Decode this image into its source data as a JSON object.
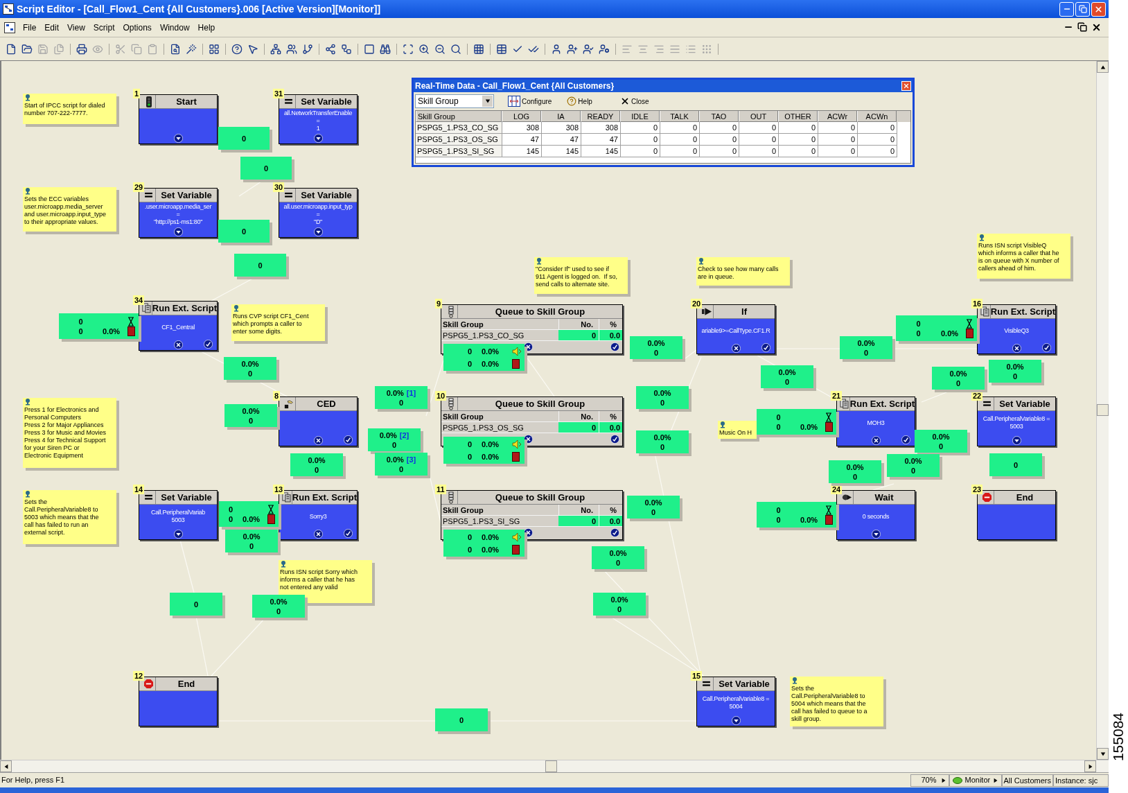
{
  "window": {
    "title": "Script Editor - [Call_Flow1_Cent {All Customers}.006 [Active Version][Monitor]]"
  },
  "menu": [
    "File",
    "Edit",
    "View",
    "Script",
    "Options",
    "Window",
    "Help"
  ],
  "toolbar": [
    [
      {
        "disabled": false
      },
      {
        "disabled": false
      },
      {
        "disabled": true
      },
      {
        "disabled": true
      }
    ],
    [
      {
        "disabled": false
      },
      {
        "disabled": true
      }
    ],
    [
      {
        "disabled": true
      },
      {
        "disabled": true
      },
      {
        "disabled": true
      }
    ],
    [
      {
        "disabled": false
      },
      {
        "disabled": false
      }
    ],
    [
      {
        "disabled": false
      }
    ],
    [
      {
        "disabled": false
      },
      {
        "disabled": false
      }
    ],
    [
      {
        "disabled": false
      },
      {
        "disabled": false
      },
      {
        "disabled": false
      }
    ],
    [
      {
        "disabled": false
      },
      {
        "disabled": false
      }
    ],
    [
      {
        "disabled": false
      },
      {
        "disabled": false
      }
    ],
    [
      {
        "disabled": false
      },
      {
        "disabled": false
      },
      {
        "disabled": false
      },
      {
        "disabled": false
      }
    ],
    [
      {
        "disabled": false
      }
    ],
    [
      {
        "disabled": false
      },
      {
        "disabled": false
      },
      {
        "disabled": false
      }
    ],
    [
      {
        "disabled": false
      },
      {
        "disabled": false
      },
      {
        "disabled": false
      },
      {
        "disabled": false
      }
    ],
    [
      {
        "disabled": true
      },
      {
        "disabled": true
      },
      {
        "disabled": true
      },
      {
        "disabled": true
      },
      {
        "disabled": true
      },
      {
        "disabled": true
      }
    ]
  ],
  "notes": [
    "Start of IPCC script for dialed\nnumber 707-222-7777.",
    "Sets the ECC variables\nuser.microapp.media_server\nand user.microapp.input_type\nto their appropriate values.",
    "Runs CVP script CF1_Cent\nwhich prompts a caller to\nenter some digits.",
    "Press 1 for Electronics and\nPersonal Computers\nPress 2 for Major Appliances\nPress 3 for Music and Movies\nPress 4 for Technical Support\nfor your Siren PC or\nElectronic Equipment",
    "Sets the\nCall.PeripheralVariable8 to\n5003 which means that the\ncall has failed to run an\nexternal script.",
    "Runs ISN script Sorry which\ninforms a caller that he has\nnot entered any valid",
    "\"Consider If\" used to see if\n911 Agent is logged on.  If so,\nsend calls to alternate site.",
    "Check to see how many calls\nare in queue.",
    "Runs ISN script VisibleQ\nwhich informs a caller that he\nis on queue with X number of\ncallers ahead of him.",
    "Music On H",
    "Sets the\nCall.PeripheralVariable8 to\n5004 which means that the\ncall has failed to queue to a\nskill group."
  ],
  "nodes": [
    {
      "number": "1",
      "kind": "start",
      "title": "Start"
    },
    {
      "number": "31",
      "kind": "set_variable",
      "title": "Set Variable",
      "lines": [
        "all.NetworkTransferEnable",
        "=",
        "1"
      ]
    },
    {
      "number": "29",
      "kind": "set_variable",
      "title": "Set Variable",
      "lines": [
        ".user.microapp.media_ser",
        "=",
        "\"http://ps1-ms1:80\""
      ]
    },
    {
      "number": "30",
      "kind": "set_variable",
      "title": "Set Variable",
      "lines": [
        "all.user.microapp.input_typ",
        "=",
        "\"D\""
      ]
    },
    {
      "number": "34",
      "kind": "run_script",
      "title": "Run Ext. Script",
      "lines": [
        "CF1_Central"
      ]
    },
    {
      "number": "8",
      "kind": "ced",
      "title": "CED"
    },
    {
      "number": "14",
      "kind": "set_variable",
      "title": "Set Variable",
      "lines": [
        "Call.PeripheralVariab",
        "5003"
      ]
    },
    {
      "number": "13",
      "kind": "run_script",
      "title": "Run Ext. Script",
      "lines": [
        "Sorry3"
      ]
    },
    {
      "number": "12",
      "kind": "end",
      "title": "End"
    },
    {
      "number": "9",
      "kind": "queue",
      "title": "Queue to Skill Group",
      "columns": [
        "Skill Group",
        "No.",
        "%"
      ],
      "row": [
        "PSPG5_1.PS3_CO_SG",
        "0",
        "0.0"
      ]
    },
    {
      "number": "10",
      "kind": "queue",
      "title": "Queue to Skill Group",
      "columns": [
        "Skill Group",
        "No.",
        "%"
      ],
      "row": [
        "PSPG5_1.PS3_OS_SG",
        "0",
        "0.0"
      ]
    },
    {
      "number": "11",
      "kind": "queue",
      "title": "Queue to Skill Group",
      "columns": [
        "Skill Group",
        "No.",
        "%"
      ],
      "row": [
        "PSPG5_1.PS3_SI_SG",
        "0",
        "0.0"
      ]
    },
    {
      "number": "20",
      "kind": "if",
      "title": "If",
      "lines": [
        "ariable9>=CallType.CF1.R"
      ]
    },
    {
      "number": "16",
      "kind": "run_script",
      "title": "Run Ext. Script",
      "lines": [
        "VisibleQ3"
      ]
    },
    {
      "number": "21",
      "kind": "run_script",
      "title": "Run Ext. Script",
      "lines": [
        "MOH3"
      ]
    },
    {
      "number": "22",
      "kind": "set_variable",
      "title": "Set Variable",
      "lines": [
        "Call.PeripheralVariable8 =",
        "5003"
      ]
    },
    {
      "number": "24",
      "kind": "wait",
      "title": "Wait",
      "lines": [
        "0 seconds"
      ]
    },
    {
      "number": "23",
      "kind": "end",
      "title": "End"
    },
    {
      "number": "15",
      "kind": "set_variable",
      "title": "Set Variable",
      "lines": [
        "Call.PeripheralVariable8 =",
        "5004"
      ]
    }
  ],
  "stat_boxes": [
    {
      "kind": "count",
      "value": "0"
    },
    {
      "kind": "count",
      "value": "0"
    },
    {
      "kind": "count",
      "value": "0"
    },
    {
      "kind": "count",
      "value": "0"
    },
    {
      "kind": "script",
      "waiting": "0",
      "count": "0",
      "rate": "0.0%"
    },
    {
      "kind": "rate",
      "rate": "0.0%",
      "count": "0"
    },
    {
      "kind": "rate",
      "rate": "0.0%",
      "count": "0"
    },
    {
      "kind": "rate",
      "rate": "0.0%",
      "count": "0"
    },
    {
      "kind": "script",
      "waiting": "0",
      "count": "0",
      "rate": "0.0%"
    },
    {
      "kind": "rate",
      "rate": "0.0%",
      "count": "0"
    },
    {
      "kind": "count",
      "value": "0"
    },
    {
      "kind": "rate",
      "rate": "0.0%",
      "count": "0"
    },
    {
      "kind": "rate",
      "rate": "0.0%",
      "branch": "[1]",
      "count": "0"
    },
    {
      "kind": "rate",
      "rate": "0.0%",
      "branch": "[2]",
      "count": "0"
    },
    {
      "kind": "rate",
      "rate": "0.0%",
      "branch": "[3]",
      "count": "0"
    },
    {
      "kind": "queue",
      "rows": [
        {
          "count": "0",
          "rate": "0.0%"
        },
        {
          "count": "0",
          "rate": "0.0%"
        }
      ]
    },
    {
      "kind": "queue",
      "rows": [
        {
          "count": "0",
          "rate": "0.0%"
        },
        {
          "count": "0",
          "rate": "0.0%"
        }
      ]
    },
    {
      "kind": "queue",
      "rows": [
        {
          "count": "0",
          "rate": "0.0%"
        },
        {
          "count": "0",
          "rate": "0.0%"
        }
      ]
    },
    {
      "kind": "rate",
      "rate": "0.0%",
      "count": "0"
    },
    {
      "kind": "rate",
      "rate": "0.0%",
      "count": "0"
    },
    {
      "kind": "rate",
      "rate": "0.0%",
      "count": "0"
    },
    {
      "kind": "rate",
      "rate": "0.0%",
      "count": "0"
    },
    {
      "kind": "rate",
      "rate": "0.0%",
      "count": "0"
    },
    {
      "kind": "rate",
      "rate": "0.0%",
      "count": "0"
    },
    {
      "kind": "rate",
      "rate": "0.0%",
      "count": "0"
    },
    {
      "kind": "rate",
      "rate": "0.0%",
      "count": "0"
    },
    {
      "kind": "script",
      "waiting": "0",
      "count": "0",
      "rate": "0.0%"
    },
    {
      "kind": "rate",
      "rate": "0.0%",
      "count": "0"
    },
    {
      "kind": "rate",
      "rate": "0.0%",
      "count": "0"
    },
    {
      "kind": "script",
      "waiting": "0",
      "count": "0",
      "rate": "0.0%"
    },
    {
      "kind": "rate",
      "rate": "0.0%",
      "count": "0"
    },
    {
      "kind": "rate",
      "rate": "0.0%",
      "count": "0"
    },
    {
      "kind": "rate",
      "rate": "0.0%",
      "count": "0"
    },
    {
      "kind": "count",
      "value": "0"
    },
    {
      "kind": "script",
      "waiting": "0",
      "count": "0",
      "rate": "0.0%"
    },
    {
      "kind": "count",
      "value": "0"
    }
  ],
  "realtime_window": {
    "title": "Real-Time Data - Call_Flow1_Cent {All Customers}",
    "dropdown": {
      "value": "Skill Group"
    },
    "buttons": [
      "Configure",
      "Help",
      "Close"
    ],
    "columns": [
      "Skill Group",
      "LOG",
      "IA",
      "READY",
      "IDLE",
      "TALK",
      "TAO",
      "OUT",
      "OTHER",
      "ACWr",
      "ACWn"
    ],
    "rows": [
      [
        "PSPG5_1.PS3_CO_SG",
        "308",
        "308",
        "308",
        "0",
        "0",
        "0",
        "0",
        "0",
        "0",
        "0"
      ],
      [
        "PSPG5_1.PS3_OS_SG",
        "47",
        "47",
        "47",
        "0",
        "0",
        "0",
        "0",
        "0",
        "0",
        "0"
      ],
      [
        "PSPG5_1.PS3_SI_SG",
        "145",
        "145",
        "145",
        "0",
        "0",
        "0",
        "0",
        "0",
        "0",
        "0"
      ]
    ]
  },
  "status_bar": {
    "help": "For Help, press F1",
    "zoom": "70%",
    "mode": "Monitor",
    "customer": "All Customers",
    "instance": "Instance: sjc"
  },
  "figure_id": "155084"
}
